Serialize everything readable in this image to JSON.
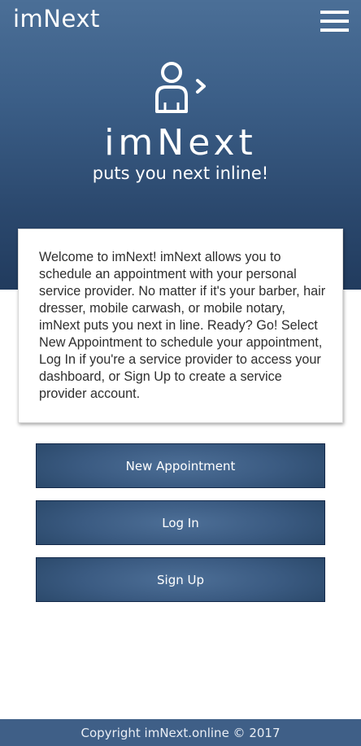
{
  "header": {
    "brand": "imNext",
    "menu_icon": "hamburger-menu-icon"
  },
  "hero": {
    "logo_icon": "person-next-icon",
    "logo_word": "imNext",
    "tagline": "puts you next inline!"
  },
  "welcome": {
    "text": "Welcome to imNext! imNext allows you to schedule an appointment with your personal service provider. No matter if it's your barber, hair dresser, mobile carwash, or mobile notary, imNext puts you next in line. Ready? Go! Select New Appointment to schedule your appointment, Log In if you're a service provider to access your dashboard, or Sign Up to create a service provider account."
  },
  "actions": {
    "new_appointment": "New Appointment",
    "log_in": "Log In",
    "sign_up": "Sign Up"
  },
  "footer": {
    "copyright": "Copyright imNext.online © 2017"
  },
  "colors": {
    "brand_blue": "#3b5e87",
    "hero_dark": "#213b5e",
    "footer_bg": "#3f5f87"
  }
}
